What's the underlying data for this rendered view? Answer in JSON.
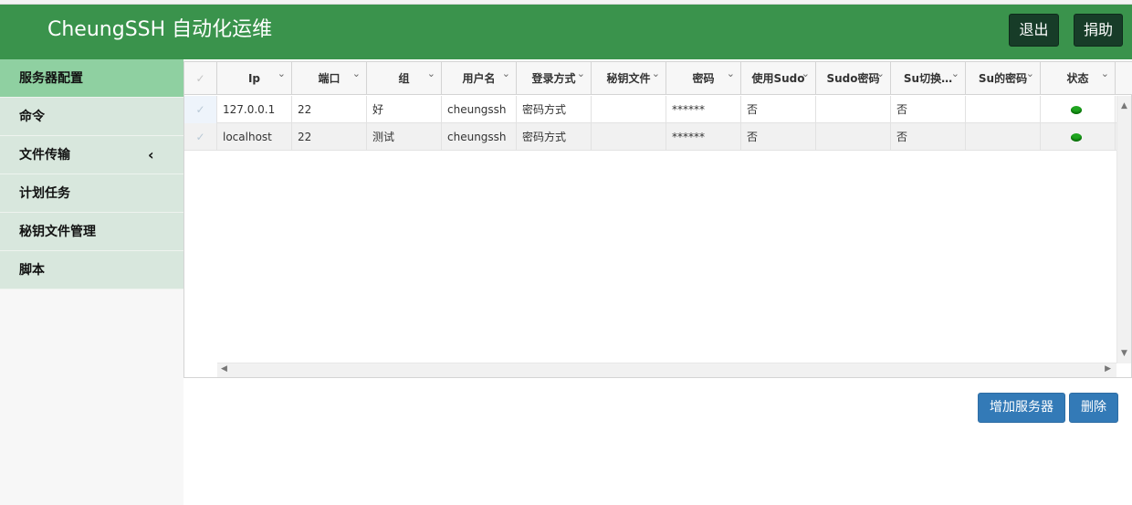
{
  "header": {
    "title": "CheungSSH 自动化运维",
    "logout_label": "退出",
    "donate_label": "捐助",
    "bg_color": "#3a934c"
  },
  "sidebar": {
    "items": [
      {
        "label": "服务器配置",
        "active": true
      },
      {
        "label": "命令"
      },
      {
        "label": "文件传输",
        "icon": "chevron-left-icon"
      },
      {
        "label": "计划任务"
      },
      {
        "label": "秘钥文件管理"
      },
      {
        "label": "脚本"
      }
    ]
  },
  "grid": {
    "columns": [
      "Ip",
      "端口",
      "组",
      "用户名",
      "登录方式",
      "秘钥文件",
      "密码",
      "使用Sudo",
      "Sudo密码",
      "Su切换…",
      "Su的密码",
      "状态"
    ],
    "rows": [
      {
        "ip": "127.0.0.1",
        "port": "22",
        "group": "好",
        "user": "cheungssh",
        "login": "密码方式",
        "keyfile": "",
        "password": "******",
        "sudo": "否",
        "sudo_pw": "",
        "su": "否",
        "su_pw": "",
        "status": "online"
      },
      {
        "ip": "localhost",
        "port": "22",
        "group": "测试",
        "user": "cheungssh",
        "login": "密码方式",
        "keyfile": "",
        "password": "******",
        "sudo": "否",
        "sudo_pw": "",
        "su": "否",
        "su_pw": "",
        "status": "online"
      }
    ],
    "status_color": "#1fa51f"
  },
  "actions": {
    "add_label": "增加服务器",
    "delete_label": "删除",
    "button_color": "#337ab7"
  }
}
